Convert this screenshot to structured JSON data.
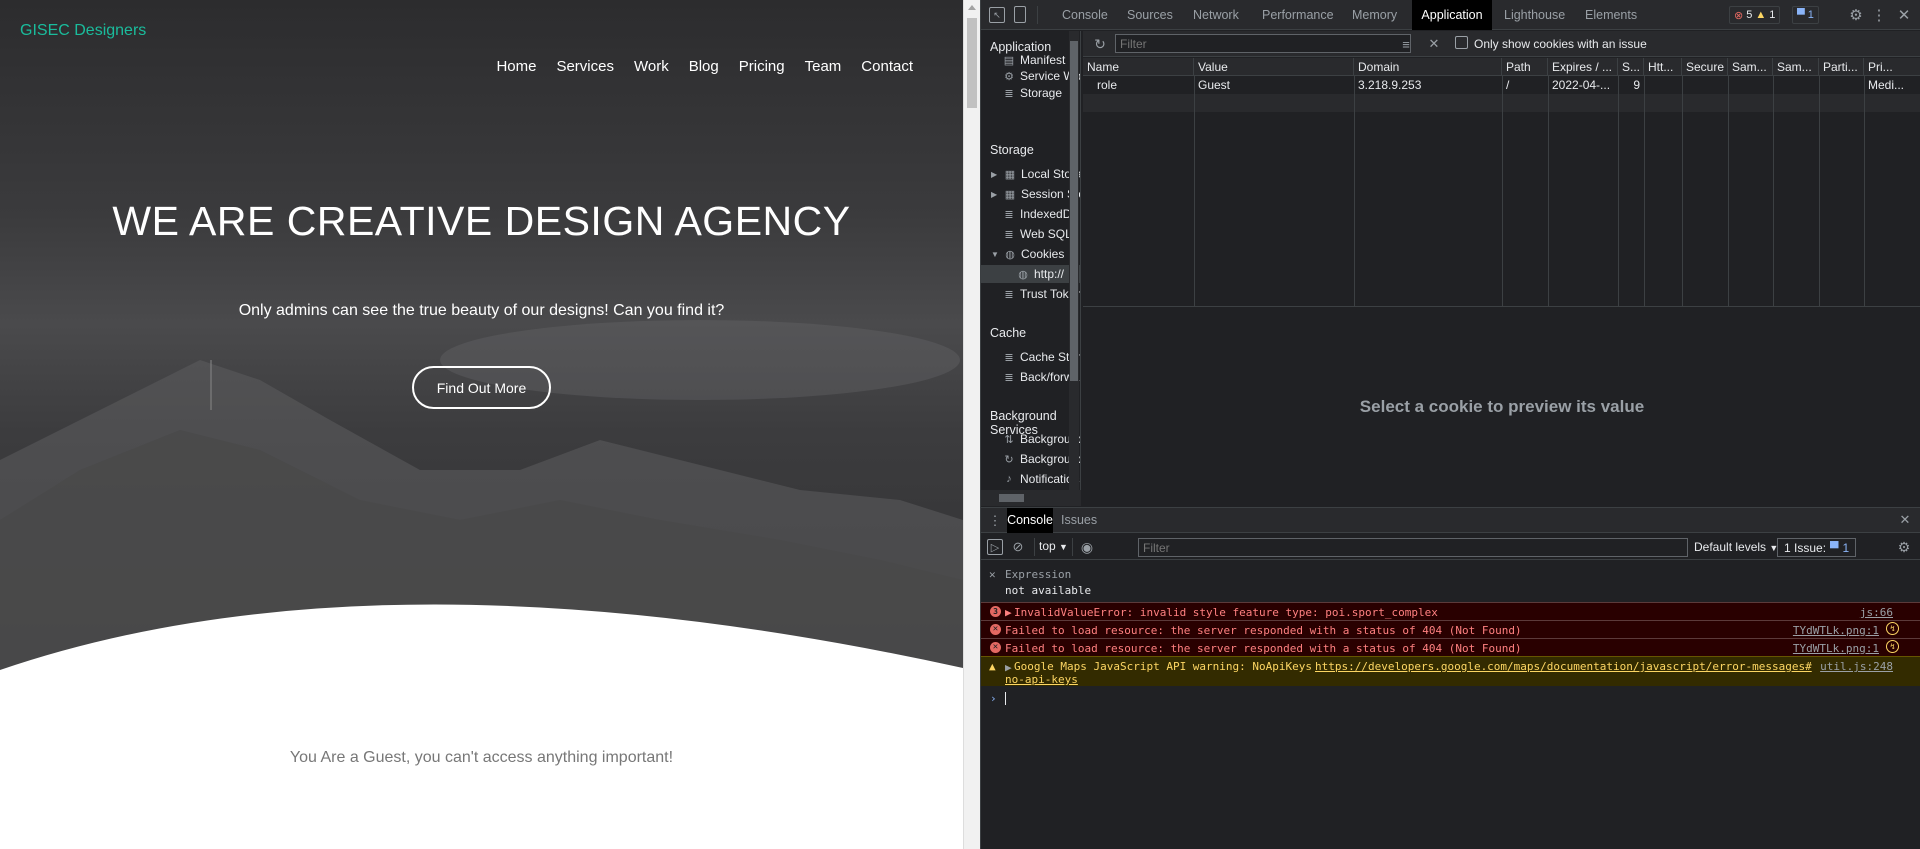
{
  "site": {
    "brand": "GISEC Designers",
    "nav": [
      "Home",
      "Services",
      "Work",
      "Blog",
      "Pricing",
      "Team",
      "Contact"
    ],
    "hero_title": "WE ARE CREATIVE DESIGN AGENCY",
    "hero_subtitle": "Only admins can see the true beauty of our designs! Can you find it?",
    "hero_button": "Find Out More",
    "guest_message": "You Are a Guest, you can't access anything important!"
  },
  "devtools": {
    "tabs": [
      "Console",
      "Sources",
      "Network",
      "Performance",
      "Memory",
      "Application",
      "Lighthouse",
      "Elements"
    ],
    "active_tab": "Application",
    "badges": {
      "errors": "5",
      "warnings": "1",
      "messages": "1"
    },
    "sidebar": {
      "application_header": "Application",
      "application_items": [
        "Manifest",
        "Service Workers",
        "Storage"
      ],
      "storage_header": "Storage",
      "storage_items": [
        "Local Storage",
        "Session Storage",
        "IndexedDB",
        "Web SQL",
        "Cookies",
        "http://",
        "Trust Tokens"
      ],
      "cache_header": "Cache",
      "cache_items": [
        "Cache Storage",
        "Back/forward cache"
      ],
      "background_header": "Background Services",
      "background_items": [
        "Background Fetch",
        "Background Sync",
        "Notifications"
      ]
    },
    "cookies": {
      "filter_placeholder": "Filter",
      "only_issues_label": "Only show cookies with an issue",
      "columns": [
        "Name",
        "Value",
        "Domain",
        "Path",
        "Expires / ...",
        "S...",
        "Htt...",
        "Secure",
        "Sam...",
        "Sam...",
        "Parti...",
        "Pri..."
      ],
      "rows": [
        [
          "role",
          "Guest",
          "3.218.9.253",
          "/",
          "2022-04-...",
          "9",
          "",
          "",
          "",
          "",
          "",
          "Medi..."
        ]
      ],
      "preview_text": "Select a cookie to preview its value"
    },
    "drawer": {
      "tabs": [
        "Console",
        "Issues"
      ],
      "context": "top",
      "filter_placeholder": "Filter",
      "levels": "Default levels",
      "issues_label": "1 Issue:",
      "issues_count": "1",
      "expression_label": "Expression",
      "expression_value": "not available",
      "messages": [
        {
          "type": "error",
          "count": "3",
          "text": "InvalidValueError: invalid style feature type: poi.sport_complex",
          "source": "js:66"
        },
        {
          "type": "error",
          "text": "Failed to load resource: the server responded with a status of 404 (Not Found)",
          "source": "TYdWTLk.png:1"
        },
        {
          "type": "error",
          "text": "Failed to load resource: the server responded with a status of 404 (Not Found)",
          "source": "TYdWTLk.png:1"
        },
        {
          "type": "warning",
          "text": "Google Maps JavaScript API warning: NoApiKeys",
          "link": "https://developers.google.com/maps/documentation/javascript/error-messages#",
          "link2": "no-api-keys",
          "source": "util.js:248"
        }
      ]
    }
  }
}
